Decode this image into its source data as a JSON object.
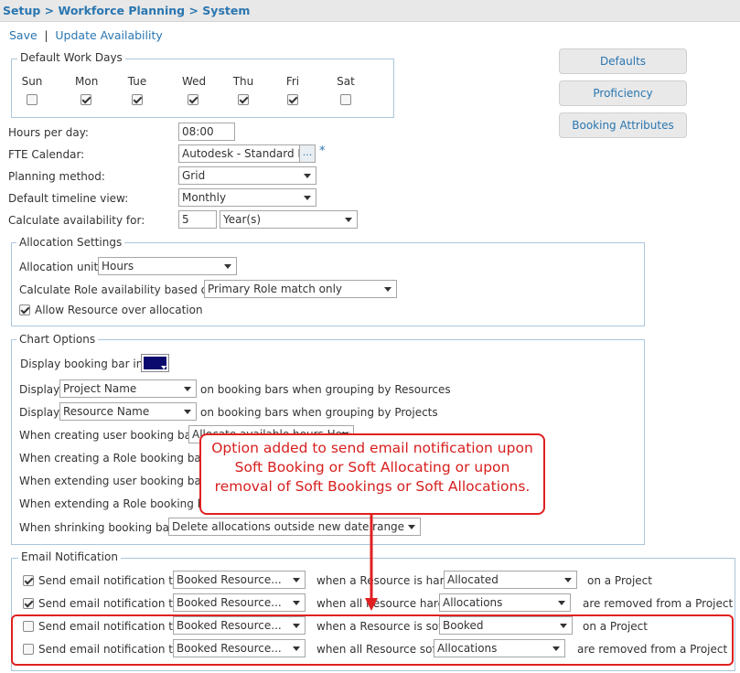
{
  "breadcrumb": "Setup > Workforce Planning > System",
  "actions": {
    "save": "Save",
    "separator": "|",
    "update": "Update Availability"
  },
  "work_days": {
    "legend": "Default Work Days",
    "days": [
      {
        "label": "Sun",
        "checked": false
      },
      {
        "label": "Mon",
        "checked": true
      },
      {
        "label": "Tue",
        "checked": true
      },
      {
        "label": "Wed",
        "checked": true
      },
      {
        "label": "Thu",
        "checked": true
      },
      {
        "label": "Fri",
        "checked": true
      },
      {
        "label": "Sat",
        "checked": false
      }
    ]
  },
  "side_buttons": {
    "defaults": "Defaults",
    "proficiency": "Proficiency",
    "booking_attributes": "Booking Attributes"
  },
  "general": {
    "hours_label": "Hours per day:",
    "hours_value": "08:00",
    "fte_label": "FTE Calendar:",
    "fte_value": "Autodesk - Standard Fu",
    "fte_btn": "...",
    "fte_required": "*",
    "planning_label": "Planning method:",
    "planning_value": "Grid",
    "timeline_label": "Default timeline view:",
    "timeline_value": "Monthly",
    "calc_label": "Calculate availability for:",
    "calc_number": "5",
    "calc_unit": "Year(s)"
  },
  "allocation": {
    "legend": "Allocation Settings",
    "unit_label": "Allocation unit:",
    "unit_value": "Hours",
    "role_label": "Calculate Role availability based on:",
    "role_value": "Primary Role match only",
    "over_label": "Allow Resource over allocation",
    "over_checked": true
  },
  "chart_options": {
    "legend": "Chart Options",
    "bar_label": "Display booking bar in:",
    "bar_color": "#0a0a6e",
    "display1_prefix": "Display",
    "display1_value": "Project Name",
    "display1_suffix": "on booking bars when grouping by Resources",
    "display2_prefix": "Display",
    "display2_value": "Resource Name",
    "display2_suffix": "on booking bars when grouping by Projects",
    "creating_user": "When creating user booking bar:",
    "creating_user_value": "Allocate available hours Hours",
    "creating_role": "When creating a Role booking bar:",
    "extending_user": "When extending user booking bar:",
    "extending_role": "When extending a Role booking bar:",
    "shrinking": "When shrinking booking bar:",
    "shrinking_value": "Delete allocations outside new date range"
  },
  "callout": "Option added to send email notification upon Soft Booking or Soft Allocating or upon removal of Soft Bookings or Soft Allocations.",
  "email": {
    "legend": "Email Notification",
    "rows": [
      {
        "checked": true,
        "label": "Send email notification to",
        "target": "Booked Resource...",
        "when": "when a Resource is hard",
        "state": "Allocated",
        "tail": "on a Project"
      },
      {
        "checked": true,
        "label": "Send email notification to",
        "target": "Booked Resource...",
        "when": "when all Resource hard",
        "state": "Allocations",
        "tail": "are removed from a Project"
      },
      {
        "checked": false,
        "label": "Send email notification to",
        "target": "Booked Resource...",
        "when": "when a Resource is soft",
        "state": "Booked",
        "tail": "on a Project"
      },
      {
        "checked": false,
        "label": "Send email notification to",
        "target": "Booked Resource...",
        "when": "when all Resource soft",
        "state": "Allocations",
        "tail": "are removed from a Project"
      }
    ]
  },
  "colors": {
    "link": "#2a76b0",
    "callout": "#e02020",
    "fieldset_border": "#a9c6dd"
  }
}
